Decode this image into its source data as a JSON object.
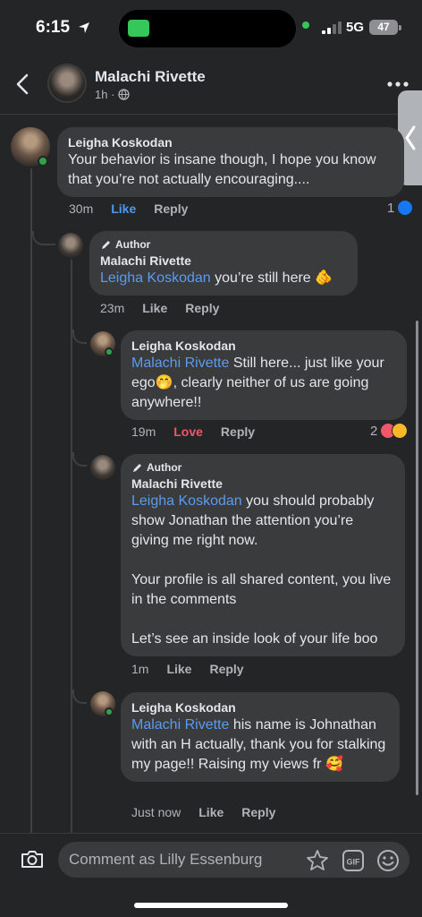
{
  "status": {
    "time": "6:15",
    "network": "5G",
    "battery": "47"
  },
  "header": {
    "name": "Malachi Rivette",
    "age": "1h ·"
  },
  "comments": [
    {
      "name": "Leigha Koskodan",
      "text": "Your behavior is insane though, I hope you know that you’re not actually encouraging....",
      "time": "30m",
      "like": "Like",
      "reply": "Reply",
      "reaction_count": "1"
    },
    {
      "author_label": "Author",
      "name": "Malachi Rivette",
      "mention": "Leigha Koskodan",
      "text": " you’re still here 🫵",
      "time": "23m",
      "like": "Like",
      "reply": "Reply"
    },
    {
      "name": "Leigha Koskodan",
      "mention": "Malachi Rivette",
      "text": " Still here... just like your ego🤭, clearly neither of us are going anywhere!!",
      "time": "19m",
      "like": "Love",
      "reply": "Reply",
      "reaction_count": "2"
    },
    {
      "author_label": "Author",
      "name": "Malachi Rivette",
      "mention": "Leigha Koskodan",
      "text": " you should probably show Jonathan the attention you’re giving me right now.\n\nYour profile is all shared content, you live in the comments\n\nLet’s see an inside look of your life boo",
      "time": "1m",
      "like": "Like",
      "reply": "Reply"
    },
    {
      "name": "Leigha Koskodan",
      "mention": "Malachi Rivette",
      "text": " his name is Johnathan with an H actually, thank you for stalking my page!! Raising my views fr 🥰",
      "time": "Just now",
      "like": "Like",
      "reply": "Reply"
    }
  ],
  "composer": {
    "placeholder": "Comment as Lilly Essenburg"
  },
  "colors": {
    "like_blue": "#4a9af0",
    "love_red": "#f0576b",
    "mention_blue": "#5b9bf0",
    "online_green": "#31a24c"
  }
}
